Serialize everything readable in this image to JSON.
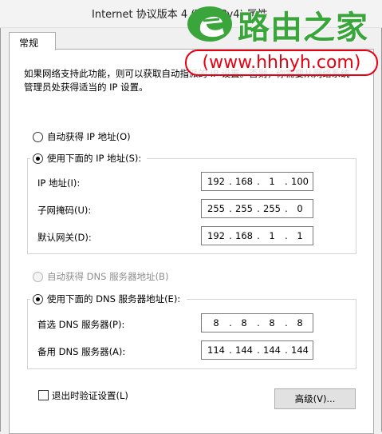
{
  "window": {
    "title": "Internet 协议版本 4 (TCP/IPv4) 属性"
  },
  "tabs": [
    {
      "label": "常规"
    }
  ],
  "description": "如果网络支持此功能，则可以获取自动指派的 IP 设置。否则，你需要从网络系统管理员处获得适当的 IP 设置。",
  "ip_mode": {
    "auto": {
      "label": "自动获得 IP 地址(O)",
      "checked": false
    },
    "manual": {
      "label": "使用下面的 IP 地址(S):",
      "checked": true
    }
  },
  "ip_fields": [
    {
      "label": "IP 地址(I):",
      "octets": [
        "192",
        "168",
        "1",
        "100"
      ]
    },
    {
      "label": "子网掩码(U):",
      "octets": [
        "255",
        "255",
        "255",
        "0"
      ]
    },
    {
      "label": "默认网关(D):",
      "octets": [
        "192",
        "168",
        "1",
        "1"
      ]
    }
  ],
  "dns_mode": {
    "auto": {
      "label": "自动获得 DNS 服务器地址(B)",
      "checked": false,
      "disabled": true
    },
    "manual": {
      "label": "使用下面的 DNS 服务器地址(E):",
      "checked": true
    }
  },
  "dns_fields": [
    {
      "label": "首选 DNS 服务器(P):",
      "octets": [
        "8",
        "8",
        "8",
        "8"
      ]
    },
    {
      "label": "备用 DNS 服务器(A):",
      "octets": [
        "114",
        "144",
        "144",
        "144"
      ]
    }
  ],
  "validate_on_exit": {
    "label": "退出时验证设置(L)",
    "checked": false
  },
  "advanced_button": {
    "label": "高级(V)..."
  },
  "watermark": {
    "brand": "路由之家",
    "url": "(www.hhhyh.com)",
    "brand_color": "#3aa53a",
    "url_color": "#e60012"
  }
}
